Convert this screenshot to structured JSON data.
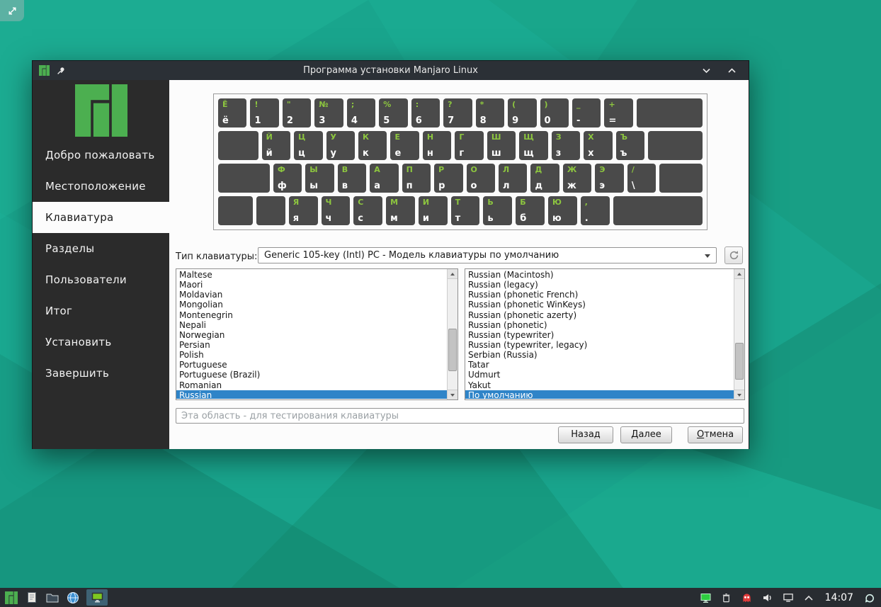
{
  "desktop": {
    "wallpaper_base_color": "#19a58d",
    "corner_widget_icon": "desktop-toolbox-icon"
  },
  "window": {
    "title": "Программа установки Manjaro Linux",
    "titlebar_icons": [
      "manjaro-logo-icon",
      "pin-icon",
      "chevron-down-icon",
      "chevron-up-icon"
    ],
    "sidebar": {
      "steps": [
        {
          "label": "Добро пожаловать",
          "active": false
        },
        {
          "label": "Местоположение",
          "active": false
        },
        {
          "label": "Клавиатура",
          "active": true
        },
        {
          "label": "Разделы",
          "active": false
        },
        {
          "label": "Пользователи",
          "active": false
        },
        {
          "label": "Итог",
          "active": false
        },
        {
          "label": "Установить",
          "active": false
        },
        {
          "label": "Завершить",
          "active": false
        }
      ]
    },
    "keyboard_page": {
      "model_label": "Тип клавиатуры:",
      "model_value": "Generic 105-key (Intl) PC  -  Модель клавиатуры по умолчанию",
      "refresh_icon": "refresh-icon",
      "layouts": {
        "selected_index": 12,
        "items": [
          "Maltese",
          "Maori",
          "Moldavian",
          "Mongolian",
          "Montenegrin",
          "Nepali",
          "Norwegian",
          "Persian",
          "Polish",
          "Portuguese",
          "Portuguese (Brazil)",
          "Romanian",
          "Russian"
        ]
      },
      "variants": {
        "selected_index": 12,
        "items": [
          "Russian (Macintosh)",
          "Russian (legacy)",
          "Russian (phonetic French)",
          "Russian (phonetic WinKeys)",
          "Russian (phonetic azerty)",
          "Russian (phonetic)",
          "Russian (typewriter)",
          "Russian (typewriter, legacy)",
          "Serbian (Russia)",
          "Tatar",
          "Udmurt",
          "Yakut",
          "По умолчанию"
        ]
      },
      "test_placeholder": "Эта область - для тестирования клавиатуры",
      "buttons": {
        "back": "Назад",
        "next": "Далее",
        "cancel": "Отмена"
      },
      "preview_rows": [
        [
          {
            "t": "Ё",
            "b": "ё"
          },
          {
            "t": "!",
            "b": "1"
          },
          {
            "t": "\"",
            "b": "2"
          },
          {
            "t": "№",
            "b": "3"
          },
          {
            "t": ";",
            "b": "4"
          },
          {
            "t": "%",
            "b": "5"
          },
          {
            "t": ":",
            "b": "6"
          },
          {
            "t": "?",
            "b": "7"
          },
          {
            "t": "*",
            "b": "8"
          },
          {
            "t": "(",
            "b": "9"
          },
          {
            "t": ")",
            "b": "0"
          },
          {
            "t": "_",
            "b": "-"
          },
          {
            "t": "+",
            "b": "="
          },
          {
            "w": 2.3
          }
        ],
        [
          {
            "w": 1.4
          },
          {
            "t": "Й",
            "b": "й"
          },
          {
            "t": "Ц",
            "b": "ц"
          },
          {
            "t": "У",
            "b": "у"
          },
          {
            "t": "К",
            "b": "к"
          },
          {
            "t": "Е",
            "b": "е"
          },
          {
            "t": "Н",
            "b": "н"
          },
          {
            "t": "Г",
            "b": "г"
          },
          {
            "t": "Ш",
            "b": "ш"
          },
          {
            "t": "Щ",
            "b": "щ"
          },
          {
            "t": "З",
            "b": "з"
          },
          {
            "t": "Х",
            "b": "х"
          },
          {
            "t": "Ъ",
            "b": "ъ"
          },
          {
            "w": 1.9
          }
        ],
        [
          {
            "w": 1.8
          },
          {
            "t": "Ф",
            "b": "ф"
          },
          {
            "t": "Ы",
            "b": "ы"
          },
          {
            "t": "В",
            "b": "в"
          },
          {
            "t": "А",
            "b": "а"
          },
          {
            "t": "П",
            "b": "п"
          },
          {
            "t": "Р",
            "b": "р"
          },
          {
            "t": "О",
            "b": "о"
          },
          {
            "t": "Л",
            "b": "л"
          },
          {
            "t": "Д",
            "b": "д"
          },
          {
            "t": "Ж",
            "b": "ж"
          },
          {
            "t": "Э",
            "b": "э"
          },
          {
            "t": "/",
            "b": "\\"
          },
          {
            "w": 1.5
          }
        ],
        [
          {
            "w": 1.2
          },
          {
            "w": 1
          },
          {
            "t": "Я",
            "b": "я"
          },
          {
            "t": "Ч",
            "b": "ч"
          },
          {
            "t": "С",
            "b": "с"
          },
          {
            "t": "М",
            "b": "м"
          },
          {
            "t": "И",
            "b": "и"
          },
          {
            "t": "Т",
            "b": "т"
          },
          {
            "t": "Ь",
            "b": "ь"
          },
          {
            "t": "Б",
            "b": "б"
          },
          {
            "t": "Ю",
            "b": "ю"
          },
          {
            "t": ",",
            "b": "."
          },
          {
            "w": 3.1
          }
        ]
      ]
    }
  },
  "taskbar": {
    "launcher_icons": [
      "manjaro-menu-icon",
      "notes-icon",
      "file-manager-icon",
      "browser-icon"
    ],
    "active_task_icon": "installer-task-icon",
    "tray_icons": [
      "network-display-icon",
      "trash-icon",
      "updates-icon",
      "volume-icon",
      "display-icon",
      "expand-arrow-icon"
    ],
    "clock": "14:07",
    "panel_toolbox_icon": "panel-toolbox-icon"
  }
}
